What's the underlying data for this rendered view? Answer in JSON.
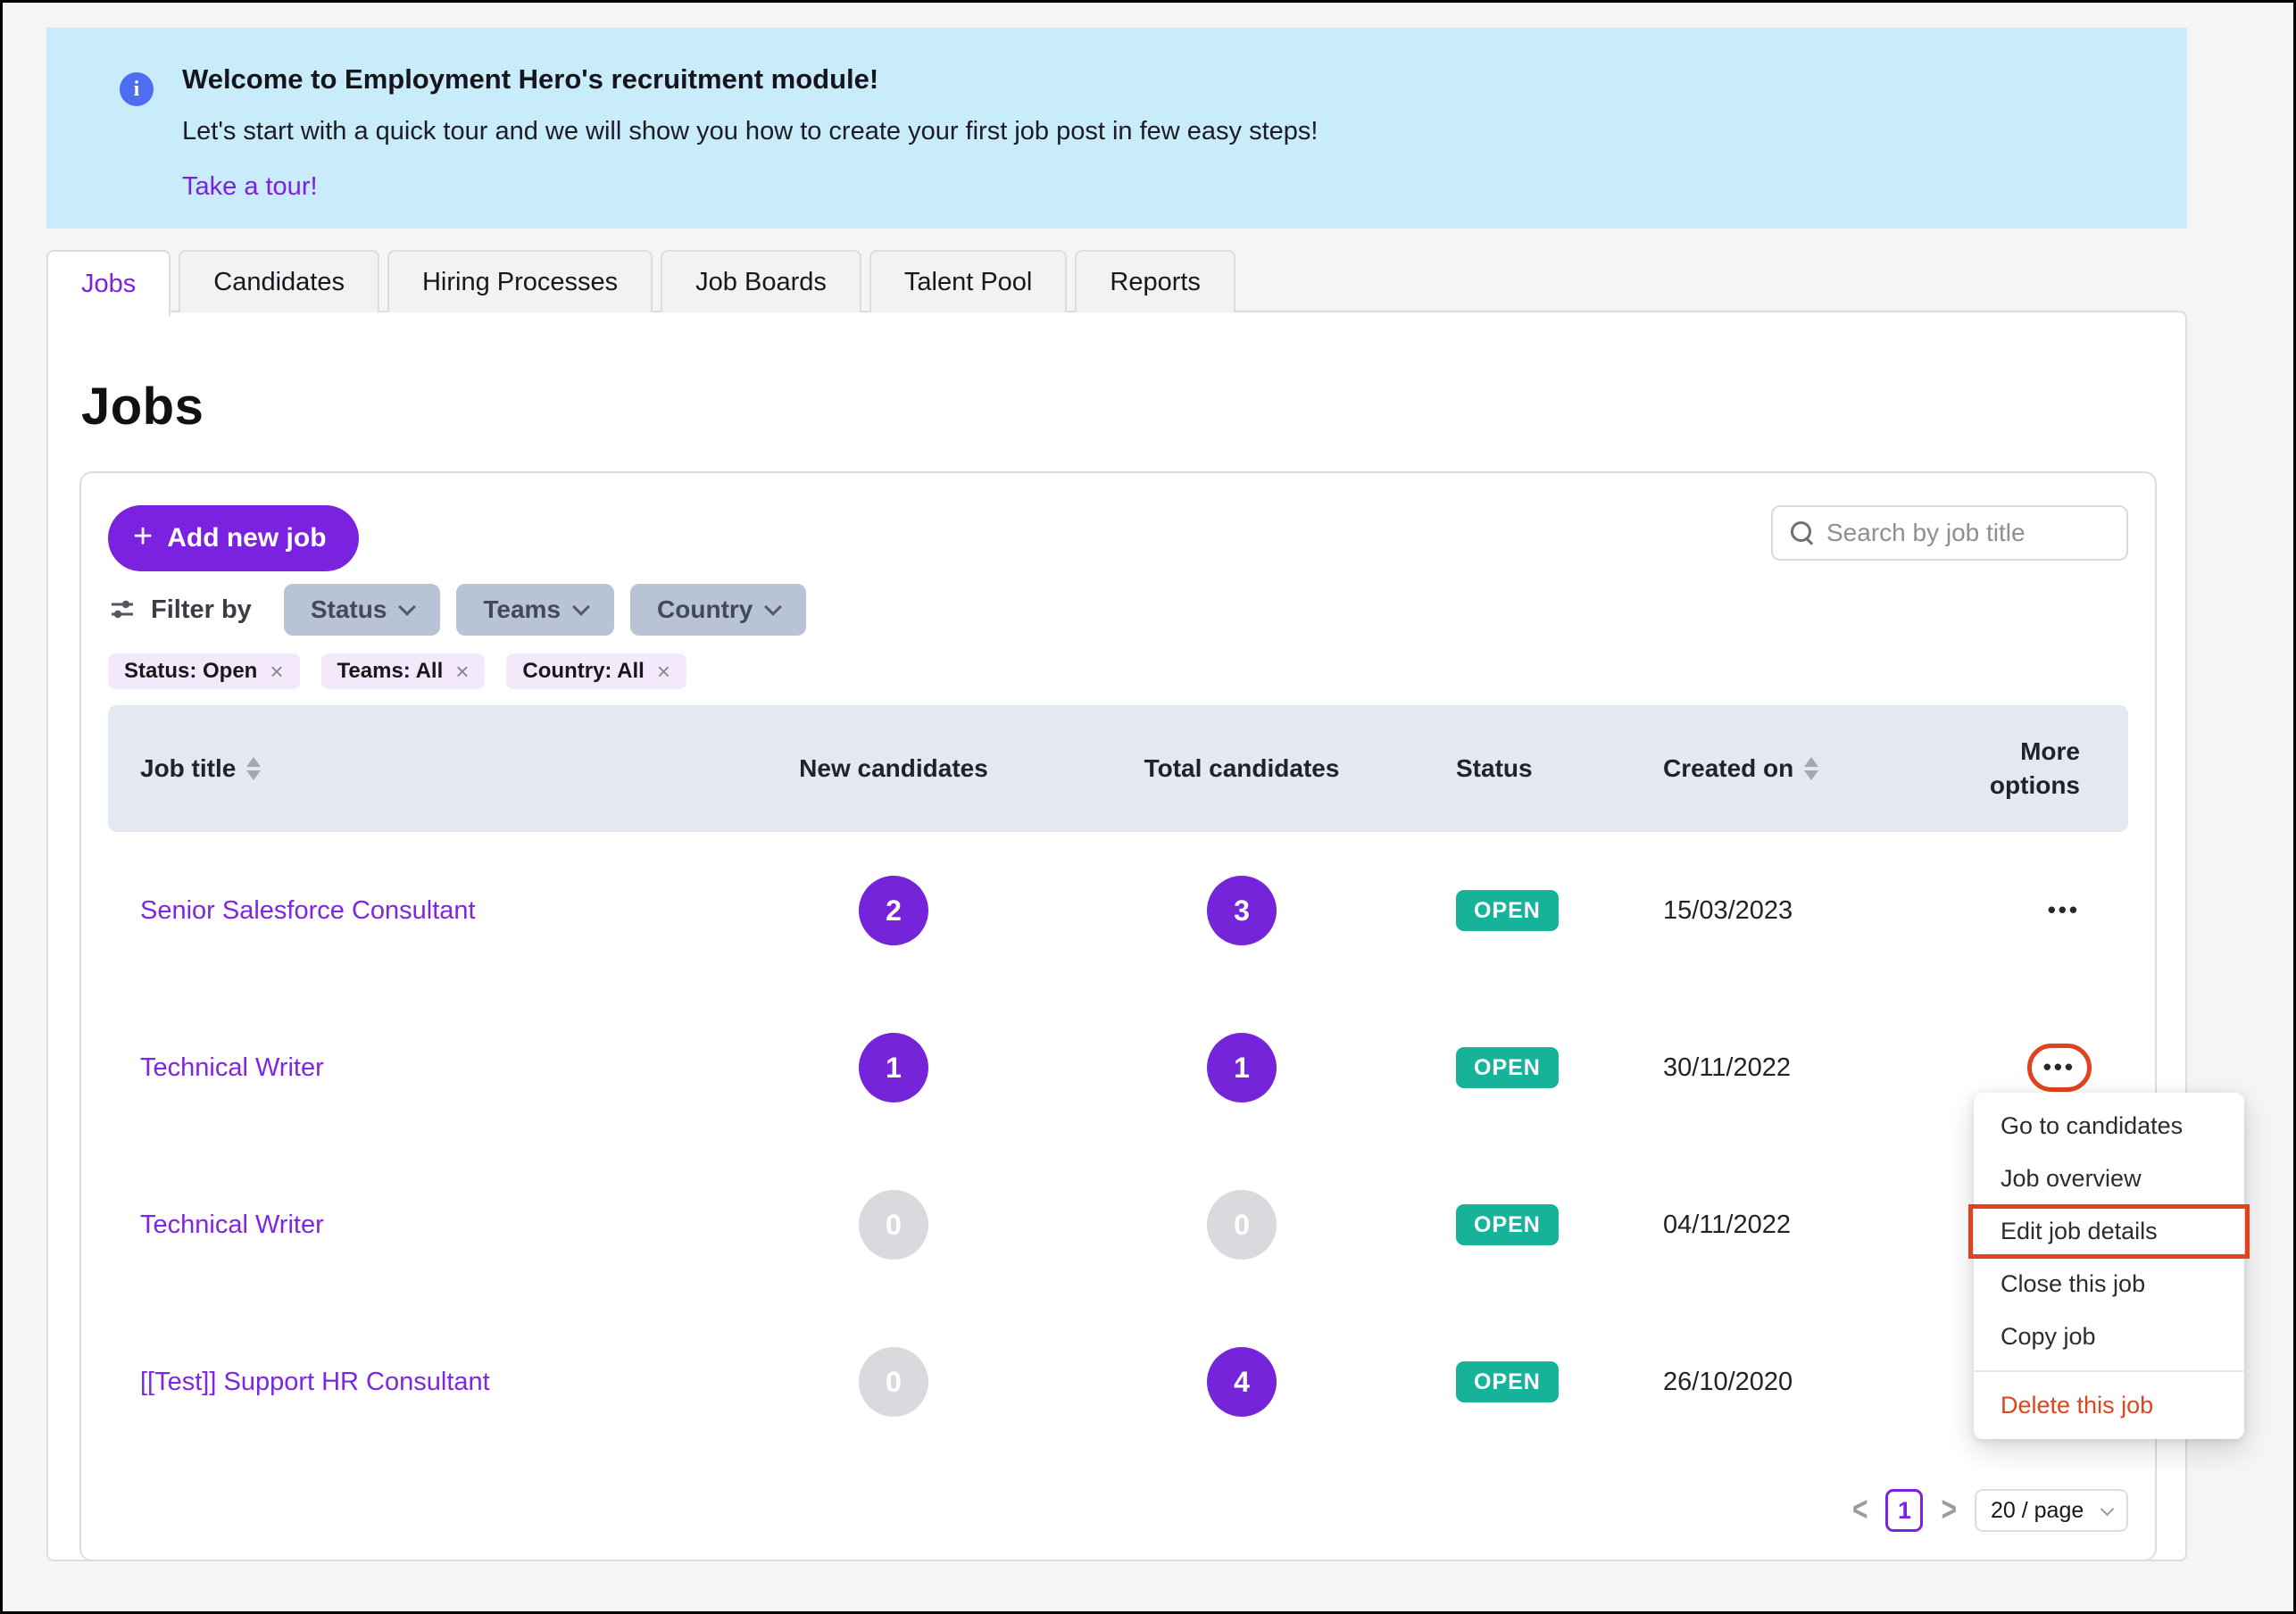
{
  "banner": {
    "title": "Welcome to Employment Hero's recruitment module!",
    "subtitle": "Let's start with a quick tour and we will show you how to create your first job post in few easy steps!",
    "link": "Take a tour!"
  },
  "tabs": [
    {
      "label": "Jobs",
      "active": true
    },
    {
      "label": "Candidates",
      "active": false
    },
    {
      "label": "Hiring Processes",
      "active": false
    },
    {
      "label": "Job Boards",
      "active": false
    },
    {
      "label": "Talent Pool",
      "active": false
    },
    {
      "label": "Reports",
      "active": false
    }
  ],
  "page": {
    "title": "Jobs"
  },
  "toolbar": {
    "add_button": "Add new job",
    "search_placeholder": "Search by job title"
  },
  "filters": {
    "label": "Filter by",
    "dropdowns": [
      "Status",
      "Teams",
      "Country"
    ],
    "chips": [
      "Status: Open",
      "Teams: All",
      "Country: All"
    ]
  },
  "table": {
    "columns": {
      "title": "Job title",
      "new": "New candidates",
      "total": "Total candidates",
      "status": "Status",
      "created": "Created on",
      "more": "More options"
    },
    "rows": [
      {
        "title": "Senior Salesforce Consultant",
        "new": "2",
        "total": "3",
        "status": "OPEN",
        "created": "15/03/2023"
      },
      {
        "title": "Technical Writer",
        "new": "1",
        "total": "1",
        "status": "OPEN",
        "created": "30/11/2022"
      },
      {
        "title": "Technical Writer",
        "new": "0",
        "total": "0",
        "status": "OPEN",
        "created": "04/11/2022"
      },
      {
        "title": "[[Test]] Support HR Consultant",
        "new": "0",
        "total": "4",
        "status": "OPEN",
        "created": "26/10/2020"
      }
    ]
  },
  "menu": {
    "items": [
      "Go to candidates",
      "Job overview",
      "Edit job details",
      "Close this job",
      "Copy job",
      "Delete this job"
    ]
  },
  "pagination": {
    "page": "1",
    "page_size": "20 / page"
  },
  "icons": {
    "info": "i",
    "plus": "+",
    "close": "×",
    "ellipsis": "•••",
    "chevron_left": "<",
    "chevron_right": ">"
  },
  "colors": {
    "accent_purple": "#7b21e0",
    "status_green": "#16b29a",
    "annotation_red": "#e2431c",
    "banner_blue_bg": "#c9ecfb",
    "info_blue": "#4d6ef2",
    "header_bg": "#e4e8f0",
    "pill_bg": "#b8c4d5",
    "chip_bg": "#f3e9fb"
  }
}
